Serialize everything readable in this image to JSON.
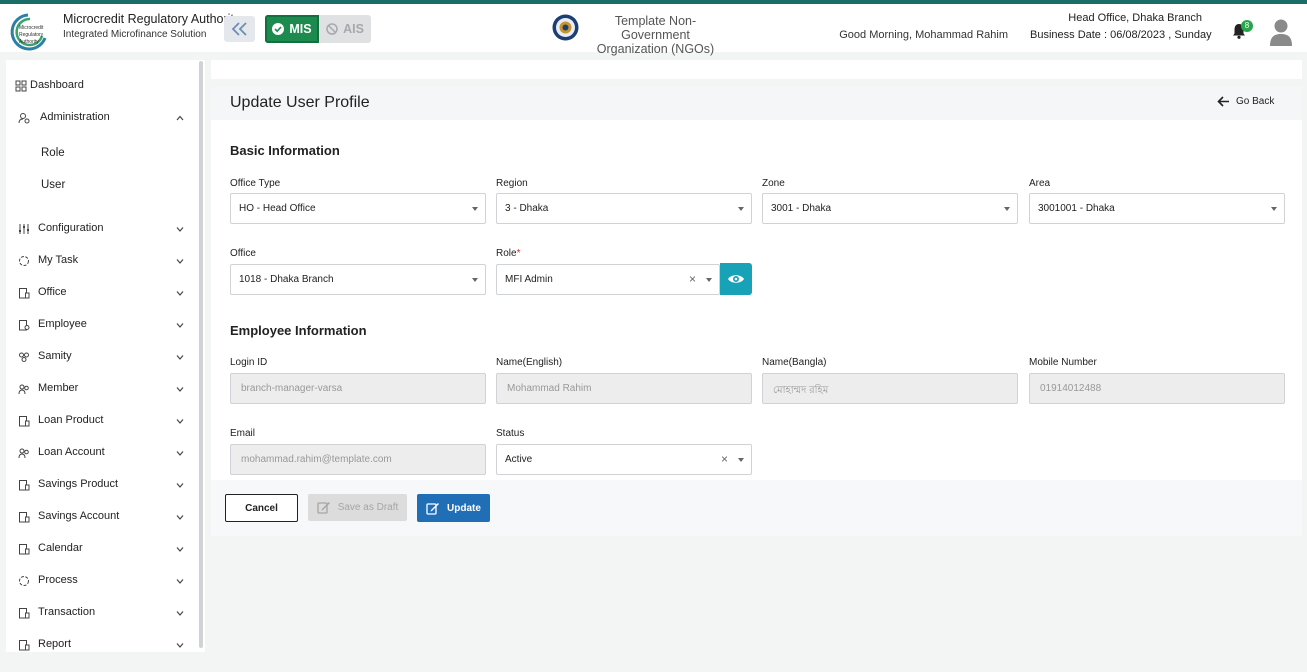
{
  "header": {
    "org_name": "Microcredit Regulatory Authority",
    "org_subtitle": "Integrated Microfinance Solution",
    "logo_lines": [
      "Microcredit",
      "Regulatory",
      "Authority"
    ],
    "mode_mis": "MIS",
    "mode_ais": "AIS",
    "tenant_line1": "Template Non-Government",
    "tenant_line2": "Organization (NGOs)",
    "greeting": "Good Morning, Mohammad Rahim",
    "branch": "Head Office, Dhaka Branch",
    "business_date": "Business Date : 06/08/2023 , Sunday",
    "notification_count": "8"
  },
  "sidebar": {
    "dashboard": "Dashboard",
    "administration": "Administration",
    "sub_items": [
      "Role",
      "User"
    ],
    "items": [
      "Configuration",
      "My Task",
      "Office",
      "Employee",
      "Samity",
      "Member",
      "Loan Product",
      "Loan Account",
      "Savings Product",
      "Savings Account",
      "Calendar",
      "Process",
      "Transaction",
      "Report"
    ]
  },
  "page": {
    "title": "Update User Profile",
    "go_back": "Go Back"
  },
  "basic_info": {
    "title": "Basic Information",
    "office_type_label": "Office Type",
    "office_type_value": "HO - Head Office",
    "region_label": "Region",
    "region_value": "3 - Dhaka",
    "zone_label": "Zone",
    "zone_value": "3001 - Dhaka",
    "area_label": "Area",
    "area_value": "3001001 - Dhaka",
    "office_label": "Office",
    "office_value": "1018 - Dhaka Branch",
    "role_label": "Role",
    "role_required": "*",
    "role_value": "MFI Admin"
  },
  "employee_info": {
    "title": "Employee Information",
    "login_label": "Login ID",
    "login_value": "branch-manager-varsa",
    "name_en_label": "Name(English)",
    "name_en_value": "Mohammad Rahim",
    "name_bn_label": "Name(Bangla)",
    "name_bn_value": "মোহাম্মদ রহিম",
    "mobile_label": "Mobile Number",
    "mobile_value": "01914012488",
    "email_label": "Email",
    "email_value": "mohammad.rahim@template.com",
    "status_label": "Status",
    "status_value": "Active"
  },
  "actions": {
    "cancel": "Cancel",
    "draft": "Save as Draft",
    "update": "Update"
  },
  "colors": {
    "mis_green": "#1d8a4e",
    "update_blue": "#1f6eb6",
    "eye_teal": "#17a2b8",
    "top_line": "#1c6d68"
  }
}
